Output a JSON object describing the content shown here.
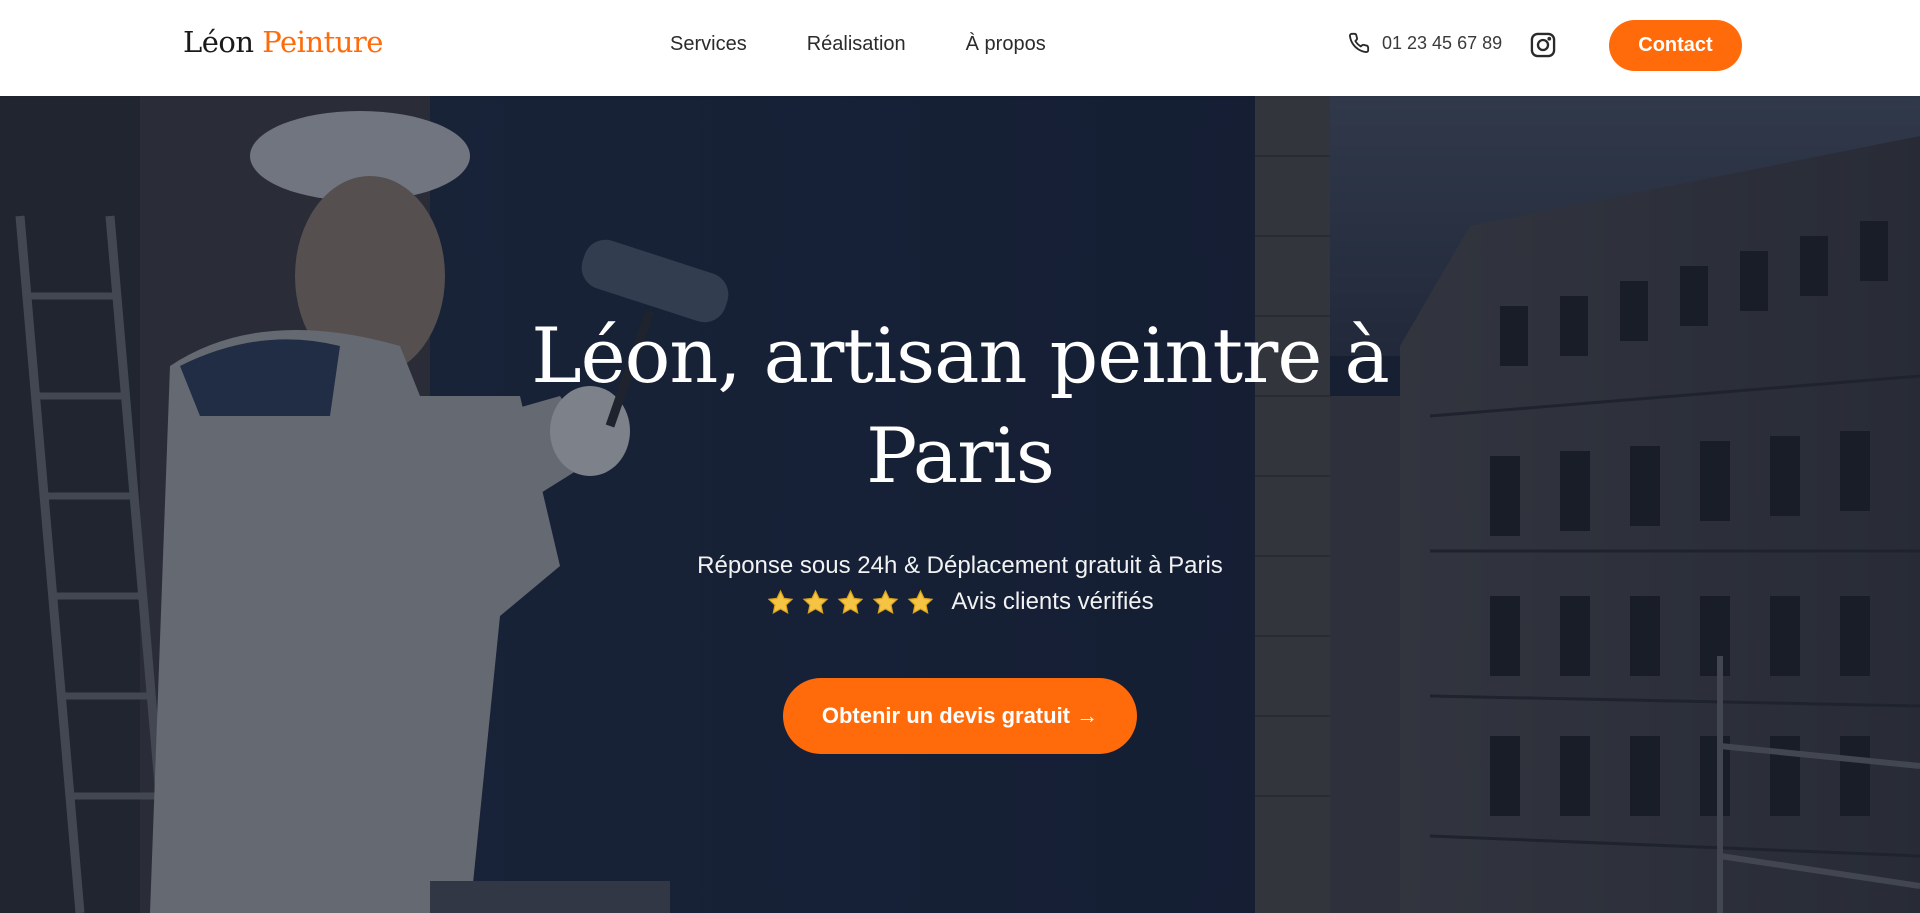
{
  "brand": {
    "name_part1": "Léon",
    "name_part2": "Peinture",
    "accent_color": "#ff6b0a"
  },
  "nav": {
    "items": [
      {
        "label": "Services"
      },
      {
        "label": "Réalisation"
      },
      {
        "label": "À propos"
      }
    ]
  },
  "header": {
    "phone_icon": "phone-icon",
    "phone": "01 23 45 67 89",
    "instagram_icon": "instagram-icon",
    "contact_label": "Contact"
  },
  "hero": {
    "title": "Léon, artisan peintre à Paris",
    "subtitle": "Réponse sous 24h & Déplacement gratuit à Paris",
    "rating_stars": 5,
    "rating_text": "Avis clients vérifiés",
    "cta_label": "Obtenir un devis gratuit →",
    "background_image": "painter-rolling-wall-paris-building"
  }
}
